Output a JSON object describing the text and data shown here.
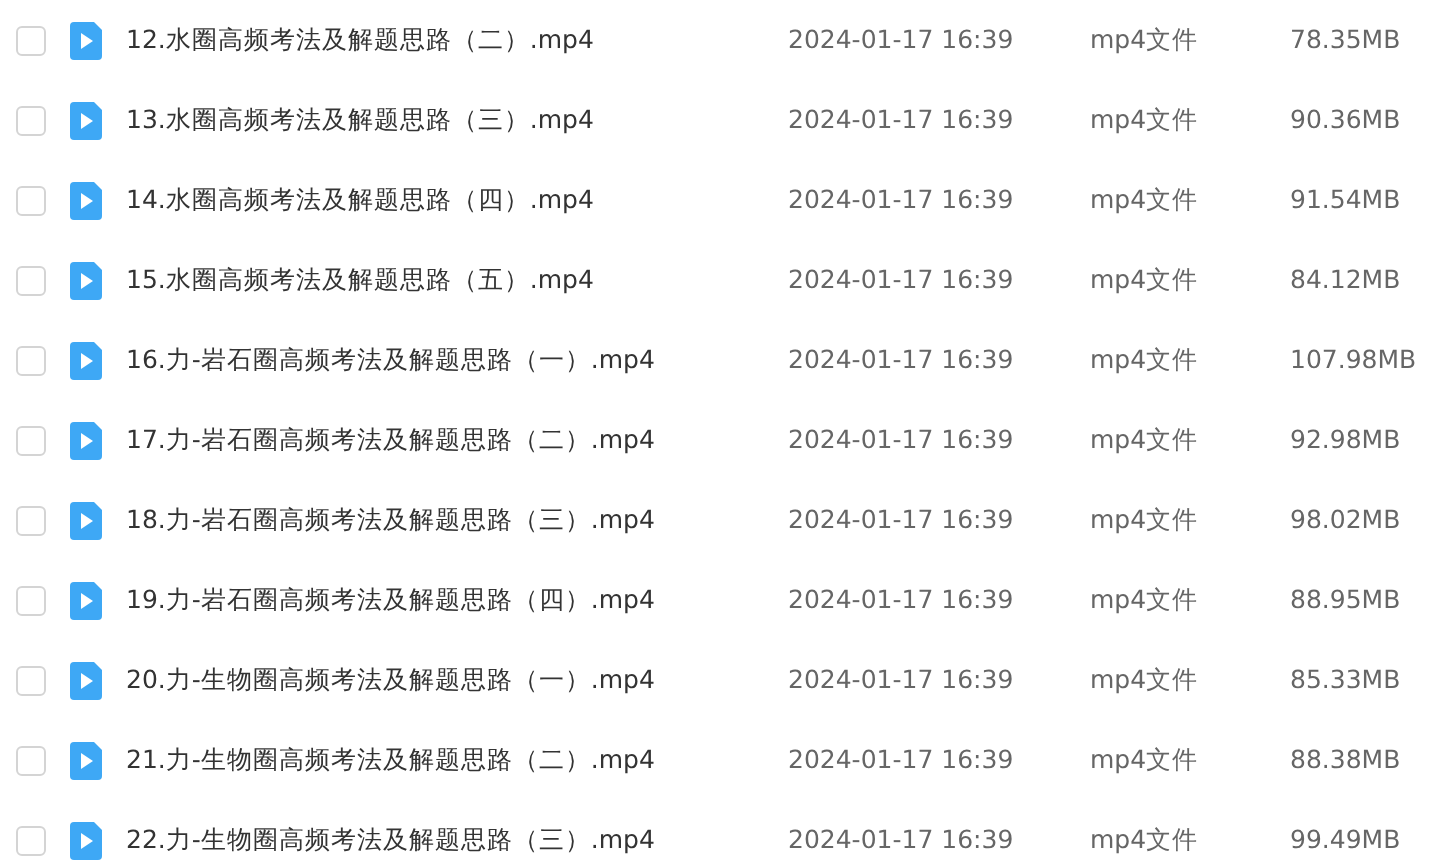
{
  "files": [
    {
      "name": "12.水圈高频考法及解题思路（二）.mp4",
      "modified": "2024-01-17 16:39",
      "type": "mp4文件",
      "size": "78.35MB",
      "checked": false
    },
    {
      "name": "13.水圈高频考法及解题思路（三）.mp4",
      "modified": "2024-01-17 16:39",
      "type": "mp4文件",
      "size": "90.36MB",
      "checked": false
    },
    {
      "name": "14.水圈高频考法及解题思路（四）.mp4",
      "modified": "2024-01-17 16:39",
      "type": "mp4文件",
      "size": "91.54MB",
      "checked": false
    },
    {
      "name": "15.水圈高频考法及解题思路（五）.mp4",
      "modified": "2024-01-17 16:39",
      "type": "mp4文件",
      "size": "84.12MB",
      "checked": false
    },
    {
      "name": "16.力-岩石圈高频考法及解题思路（一）.mp4",
      "modified": "2024-01-17 16:39",
      "type": "mp4文件",
      "size": "107.98MB",
      "checked": false
    },
    {
      "name": "17.力-岩石圈高频考法及解题思路（二）.mp4",
      "modified": "2024-01-17 16:39",
      "type": "mp4文件",
      "size": "92.98MB",
      "checked": false
    },
    {
      "name": "18.力-岩石圈高频考法及解题思路（三）.mp4",
      "modified": "2024-01-17 16:39",
      "type": "mp4文件",
      "size": "98.02MB",
      "checked": false
    },
    {
      "name": "19.力-岩石圈高频考法及解题思路（四）.mp4",
      "modified": "2024-01-17 16:39",
      "type": "mp4文件",
      "size": "88.95MB",
      "checked": false
    },
    {
      "name": "20.力-生物圈高频考法及解题思路（一）.mp4",
      "modified": "2024-01-17 16:39",
      "type": "mp4文件",
      "size": "85.33MB",
      "checked": false
    },
    {
      "name": "21.力-生物圈高频考法及解题思路（二）.mp4",
      "modified": "2024-01-17 16:39",
      "type": "mp4文件",
      "size": "88.38MB",
      "checked": false
    },
    {
      "name": "22.力-生物圈高频考法及解题思路（三）.mp4",
      "modified": "2024-01-17 16:39",
      "type": "mp4文件",
      "size": "99.49MB",
      "checked": false
    }
  ]
}
